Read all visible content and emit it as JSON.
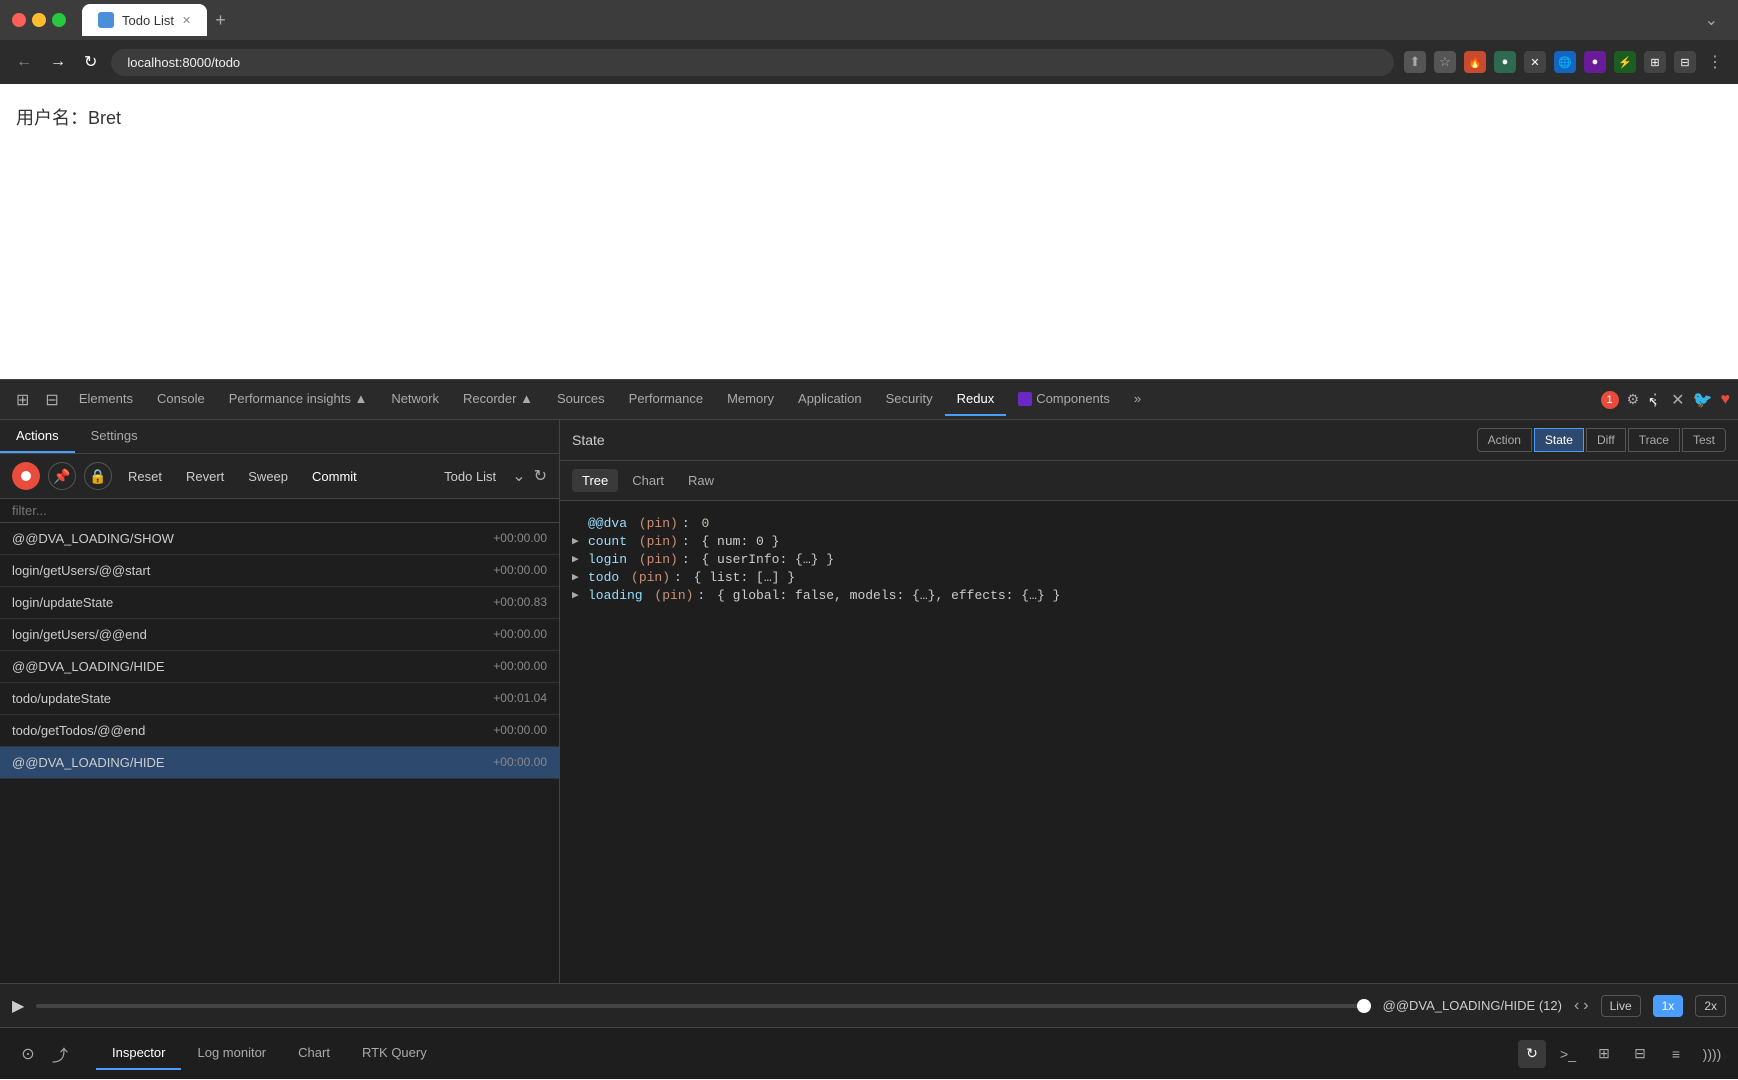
{
  "browser": {
    "tab_title": "Todo List",
    "url": "localhost:8000/todo",
    "new_tab_label": "+"
  },
  "page": {
    "username_label": "用户名：Bret"
  },
  "devtools": {
    "tabs": [
      {
        "label": "Elements",
        "active": false
      },
      {
        "label": "Console",
        "active": false
      },
      {
        "label": "Performance insights ▲",
        "active": false
      },
      {
        "label": "Network",
        "active": false
      },
      {
        "label": "Recorder ▲",
        "active": false
      },
      {
        "label": "Sources",
        "active": false
      },
      {
        "label": "Performance",
        "active": false
      },
      {
        "label": "Memory",
        "active": false
      },
      {
        "label": "Application",
        "active": false
      },
      {
        "label": "Security",
        "active": false
      },
      {
        "label": "Redux",
        "active": true
      },
      {
        "label": "Components",
        "active": false
      }
    ],
    "badge": "1"
  },
  "actions_panel": {
    "sub_tabs": [
      {
        "label": "Actions",
        "active": true
      },
      {
        "label": "Settings",
        "active": false
      }
    ],
    "toolbar": {
      "reset_label": "Reset",
      "revert_label": "Revert",
      "sweep_label": "Sweep",
      "commit_label": "Commit",
      "title": "Todo List"
    },
    "filter_placeholder": "filter...",
    "items": [
      {
        "name": "@@DVA_LOADING/SHOW",
        "time": "+00:00.00"
      },
      {
        "name": "login/getUsers/@@start",
        "time": "+00:00.00"
      },
      {
        "name": "login/updateState",
        "time": "+00:00.83"
      },
      {
        "name": "login/getUsers/@@end",
        "time": "+00:00.00"
      },
      {
        "name": "@@DVA_LOADING/HIDE",
        "time": "+00:00.00"
      },
      {
        "name": "todo/updateState",
        "time": "+00:01.04"
      },
      {
        "name": "todo/getTodos/@@end",
        "time": "+00:00.00"
      },
      {
        "name": "@@DVA_LOADING/HIDE",
        "time": "+00:00.00"
      }
    ]
  },
  "state_panel": {
    "header_title": "State",
    "tabs": [
      {
        "label": "Action",
        "active": false
      },
      {
        "label": "State",
        "active": true
      },
      {
        "label": "Diff",
        "active": false
      },
      {
        "label": "Trace",
        "active": false
      },
      {
        "label": "Test",
        "active": false
      }
    ],
    "view_tabs": [
      {
        "label": "Tree",
        "active": true
      },
      {
        "label": "Chart",
        "active": false
      },
      {
        "label": "Raw",
        "active": false
      }
    ],
    "tree_items": [
      {
        "indent": 0,
        "expandable": false,
        "key": "@@dva",
        "paren": "(pin)",
        "colon": ":",
        "value": "0",
        "type": "num"
      },
      {
        "indent": 0,
        "expandable": true,
        "key": "count",
        "paren": "(pin)",
        "colon": ":",
        "value": "{ num: 0 }",
        "type": "obj"
      },
      {
        "indent": 0,
        "expandable": true,
        "key": "login",
        "paren": "(pin)",
        "colon": ":",
        "value": "{ userInfo: {…} }",
        "type": "obj"
      },
      {
        "indent": 0,
        "expandable": true,
        "key": "todo",
        "paren": "(pin)",
        "colon": ":",
        "value": "{ list: […] }",
        "type": "obj"
      },
      {
        "indent": 0,
        "expandable": true,
        "key": "loading",
        "paren": "(pin)",
        "colon": ":",
        "value": "{ global: false, models: {…}, effects: {…} }",
        "type": "obj"
      }
    ]
  },
  "timeline": {
    "current_action": "@@DVA_LOADING/HIDE",
    "count": "(12)",
    "live_label": "Live",
    "speed_1x": "1x",
    "speed_2x": "2x"
  },
  "bottom_toolbar": {
    "tabs": [
      {
        "label": "Inspector",
        "active": true
      },
      {
        "label": "Log monitor",
        "active": false
      },
      {
        "label": "Chart",
        "active": false
      },
      {
        "label": "RTK Query",
        "active": false
      }
    ]
  }
}
